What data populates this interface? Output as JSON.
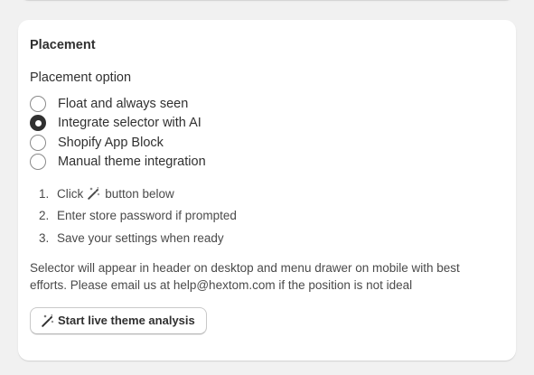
{
  "section": {
    "title": "Placement",
    "option_label": "Placement option"
  },
  "radio_options": [
    {
      "label": "Float and always seen",
      "checked": false
    },
    {
      "label": "Integrate selector with AI",
      "checked": true
    },
    {
      "label": "Shopify App Block",
      "checked": false
    },
    {
      "label": "Manual theme integration",
      "checked": false
    }
  ],
  "steps": [
    {
      "num": "1.",
      "before": "Click",
      "icon": "magic-wand-icon",
      "after": "button below"
    },
    {
      "num": "2.",
      "text": "Enter store password if prompted"
    },
    {
      "num": "3.",
      "text": "Save your settings when ready"
    }
  ],
  "description": "Selector will appear in header on desktop and menu drawer on mobile with best efforts. Please email us at help@hextom.com if the position is not ideal",
  "button": {
    "label": "Start live theme analysis",
    "icon": "magic-wand-icon"
  },
  "colors": {
    "background": "#f1f1f1",
    "card": "#ffffff",
    "text": "#303030",
    "radio_checked": "#303030"
  }
}
